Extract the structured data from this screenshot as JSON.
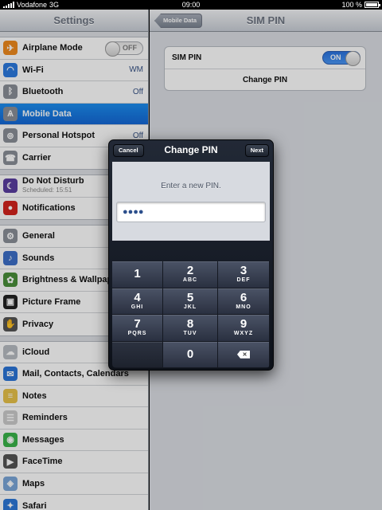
{
  "status_bar": {
    "carrier": "Vodafone",
    "network": "3G",
    "time": "09:00",
    "battery": "100 %"
  },
  "sidebar": {
    "title": "Settings",
    "groups": [
      [
        {
          "label": "Airplane Mode",
          "toggle": "OFF",
          "icon": "airplane-icon",
          "color": "#f08a1e"
        },
        {
          "label": "Wi-Fi",
          "value": "WM",
          "icon": "wifi-icon",
          "color": "#2c7be0"
        },
        {
          "label": "Bluetooth",
          "value": "Off",
          "icon": "bluetooth-icon",
          "color": "#8a8f98"
        },
        {
          "label": "Mobile Data",
          "icon": "antenna-icon",
          "color": "#8a8f98",
          "selected": true
        },
        {
          "label": "Personal Hotspot",
          "value": "Off",
          "icon": "hotspot-icon",
          "color": "#8a8f98"
        },
        {
          "label": "Carrier",
          "icon": "phone-icon",
          "color": "#8a8f98"
        }
      ],
      [
        {
          "label": "Do Not Disturb",
          "sub": "Scheduled: 15:51",
          "icon": "moon-icon",
          "color": "#5a3ea0"
        },
        {
          "label": "Notifications",
          "icon": "notifications-icon",
          "color": "#d4231d"
        }
      ],
      [
        {
          "label": "General",
          "icon": "gear-icon",
          "color": "#8a8f98"
        },
        {
          "label": "Sounds",
          "icon": "speaker-icon",
          "color": "#3d6fc9"
        },
        {
          "label": "Brightness & Wallpaper",
          "icon": "brightness-icon",
          "color": "#4a8f3a"
        },
        {
          "label": "Picture Frame",
          "icon": "picture-frame-icon",
          "color": "#222222"
        },
        {
          "label": "Privacy",
          "icon": "hand-icon",
          "color": "#555555"
        }
      ],
      [
        {
          "label": "iCloud",
          "icon": "cloud-icon",
          "color": "#b8bcc2"
        },
        {
          "label": "Mail, Contacts, Calendars",
          "icon": "mail-icon",
          "color": "#2b76d8"
        },
        {
          "label": "Notes",
          "icon": "notes-icon",
          "color": "#e8c24a"
        },
        {
          "label": "Reminders",
          "icon": "reminders-icon",
          "color": "#cccccc"
        },
        {
          "label": "Messages",
          "icon": "messages-icon",
          "color": "#3ab54a"
        },
        {
          "label": "FaceTime",
          "icon": "video-icon",
          "color": "#555555"
        },
        {
          "label": "Maps",
          "icon": "maps-icon",
          "color": "#7aa6d8"
        },
        {
          "label": "Safari",
          "icon": "compass-icon",
          "color": "#2d78d8"
        }
      ]
    ]
  },
  "detail": {
    "back_label": "Mobile Data",
    "title": "SIM PIN",
    "sim_pin_label": "SIM PIN",
    "sim_pin_toggle": "ON",
    "change_pin_label": "Change PIN"
  },
  "dialog": {
    "cancel_label": "Cancel",
    "title": "Change PIN",
    "next_label": "Next",
    "prompt": "Enter a new PIN.",
    "pin_value": "●●●●",
    "keys": [
      {
        "digit": "1",
        "letters": ""
      },
      {
        "digit": "2",
        "letters": "ABC"
      },
      {
        "digit": "3",
        "letters": "DEF"
      },
      {
        "digit": "4",
        "letters": "GHI"
      },
      {
        "digit": "5",
        "letters": "JKL"
      },
      {
        "digit": "6",
        "letters": "MNO"
      },
      {
        "digit": "7",
        "letters": "PQRS"
      },
      {
        "digit": "8",
        "letters": "TUV"
      },
      {
        "digit": "9",
        "letters": "WXYZ"
      },
      {
        "digit": "",
        "letters": ""
      },
      {
        "digit": "0",
        "letters": ""
      },
      {
        "digit": "delete",
        "letters": ""
      }
    ]
  }
}
